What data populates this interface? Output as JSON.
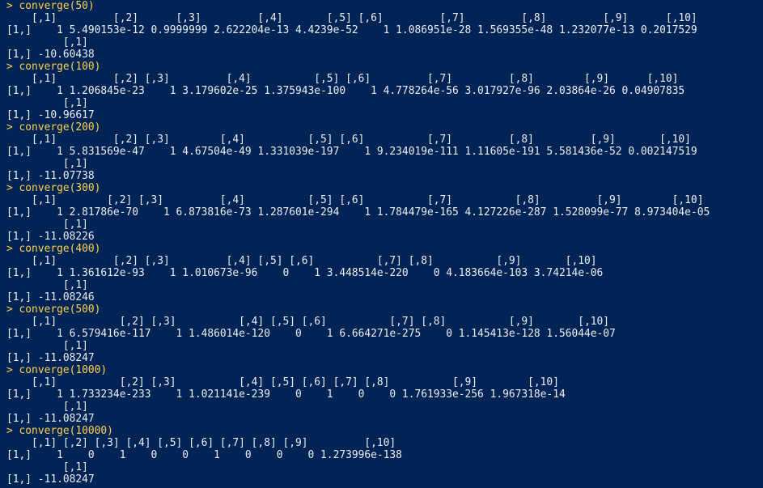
{
  "console": {
    "prompt": ">",
    "blocks": [
      {
        "command": "converge(50)",
        "matrix_header": "    [,1]         [,2]      [,3]         [,4]       [,5] [,6]         [,7]         [,8]         [,9]      [,10]",
        "matrix_row": "[1,]    1 5.490153e-12 0.9999999 2.622204e-13 4.4239e-52    1 1.086951e-28 1.569355e-48 1.232077e-13 0.2017529",
        "scalar_header": "         [,1]",
        "scalar_row": "[1,] -10.60438"
      },
      {
        "command": "converge(100)",
        "matrix_header": "    [,1]         [,2] [,3]         [,4]          [,5] [,6]         [,7]         [,8]        [,9]      [,10]",
        "matrix_row": "[1,]    1 1.206845e-23    1 3.179602e-25 1.375943e-100    1 4.778264e-56 3.017927e-96 2.03864e-26 0.04907835",
        "scalar_header": "         [,1]",
        "scalar_row": "[1,] -10.96617"
      },
      {
        "command": "converge(200)",
        "matrix_header": "    [,1]         [,2] [,3]        [,4]          [,5] [,6]          [,7]         [,8]         [,9]       [,10]",
        "matrix_row": "[1,]    1 5.831569e-47    1 4.67504e-49 1.331039e-197    1 9.234019e-111 1.11605e-191 5.581436e-52 0.002147519",
        "scalar_header": "         [,1]",
        "scalar_row": "[1,] -11.07738"
      },
      {
        "command": "converge(300)",
        "matrix_header": "    [,1]        [,2] [,3]         [,4]          [,5] [,6]          [,7]          [,8]         [,9]        [,10]",
        "matrix_row": "[1,]    1 2.81786e-70    1 6.873816e-73 1.287601e-294    1 1.784479e-165 4.127226e-287 1.528099e-77 8.973404e-05",
        "scalar_header": "         [,1]",
        "scalar_row": "[1,] -11.08226"
      },
      {
        "command": "converge(400)",
        "matrix_header": "    [,1]         [,2] [,3]         [,4] [,5] [,6]          [,7] [,8]          [,9]       [,10]",
        "matrix_row": "[1,]    1 1.361612e-93    1 1.010673e-96    0    1 3.448514e-220    0 4.183664e-103 3.74214e-06",
        "scalar_header": "         [,1]",
        "scalar_row": "[1,] -11.08246"
      },
      {
        "command": "converge(500)",
        "matrix_header": "    [,1]          [,2] [,3]          [,4] [,5] [,6]          [,7] [,8]          [,9]       [,10]",
        "matrix_row": "[1,]    1 6.579416e-117    1 1.486014e-120    0    1 6.664271e-275    0 1.145413e-128 1.56044e-07",
        "scalar_header": "         [,1]",
        "scalar_row": "[1,] -11.08247"
      },
      {
        "command": "converge(1000)",
        "matrix_header": "    [,1]          [,2] [,3]          [,4] [,5] [,6] [,7] [,8]          [,9]        [,10]",
        "matrix_row": "[1,]    1 1.733234e-233    1 1.021141e-239    0    1    0    0 1.761933e-256 1.967318e-14",
        "scalar_header": "         [,1]",
        "scalar_row": "[1,] -11.08247"
      },
      {
        "command": "converge(10000)",
        "matrix_header": "    [,1] [,2] [,3] [,4] [,5] [,6] [,7] [,8] [,9]         [,10]",
        "matrix_row": "[1,]    1    0    1    0    0    1    0    0    0 1.273996e-138",
        "scalar_header": "         [,1]",
        "scalar_row": "[1,] -11.08247"
      }
    ]
  }
}
